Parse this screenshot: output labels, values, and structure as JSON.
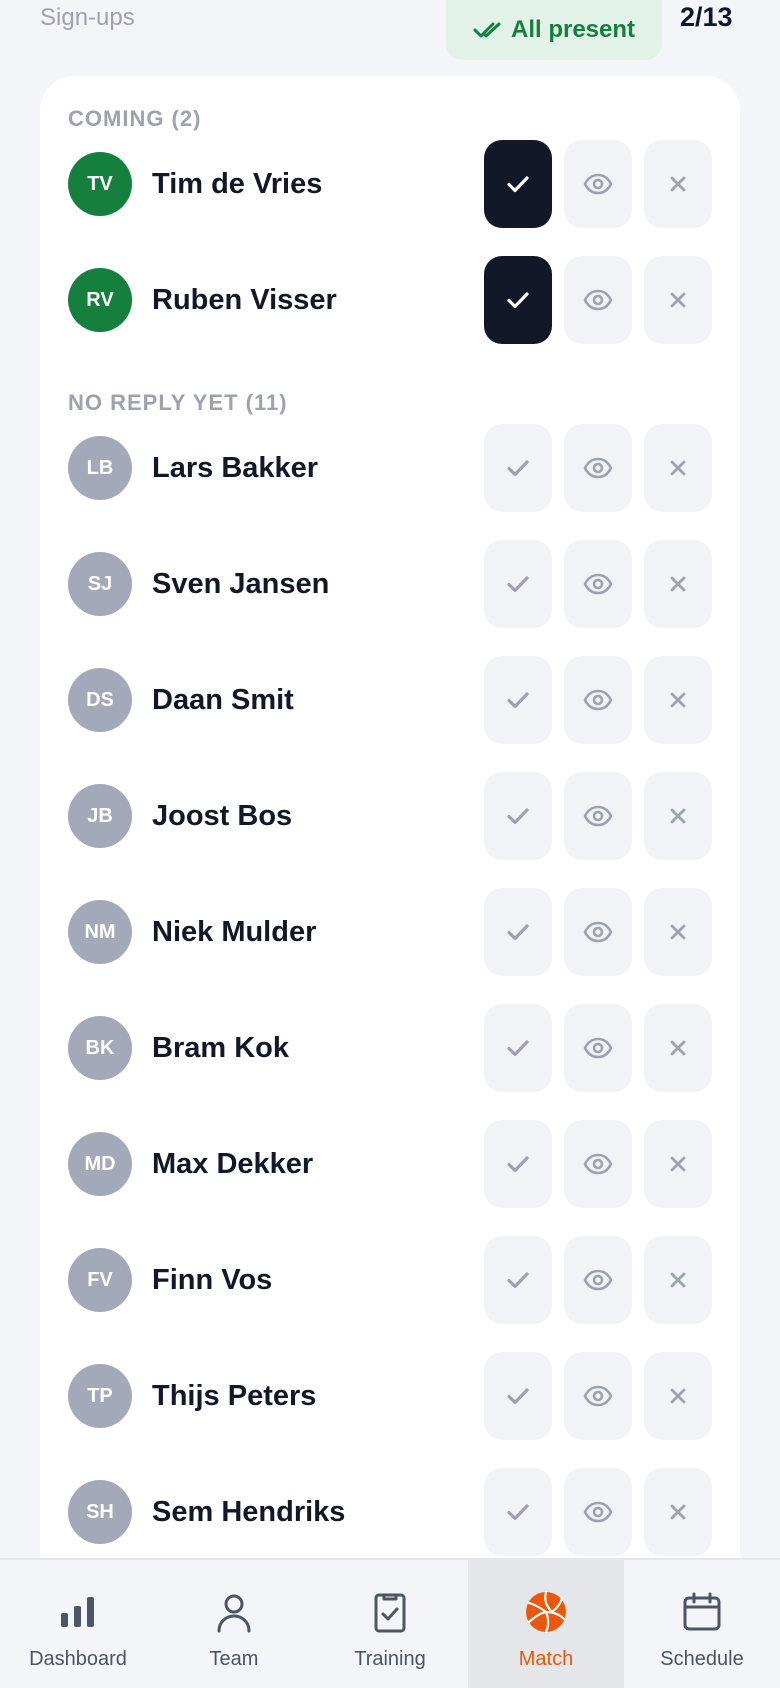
{
  "header": {
    "label": "Sign-ups",
    "badge": "All present",
    "count": "2/13"
  },
  "sections": {
    "coming": {
      "title": "COMING (2)",
      "players": [
        {
          "initials": "TV",
          "name": "Tim de Vries",
          "status": "yes"
        },
        {
          "initials": "RV",
          "name": "Ruben Visser",
          "status": "yes"
        }
      ]
    },
    "no_reply": {
      "title": "NO REPLY YET (11)",
      "players": [
        {
          "initials": "LB",
          "name": "Lars Bakker",
          "status": "none"
        },
        {
          "initials": "SJ",
          "name": "Sven Jansen",
          "status": "none"
        },
        {
          "initials": "DS",
          "name": "Daan Smit",
          "status": "none"
        },
        {
          "initials": "JB",
          "name": "Joost Bos",
          "status": "none"
        },
        {
          "initials": "NM",
          "name": "Niek Mulder",
          "status": "none"
        },
        {
          "initials": "BK",
          "name": "Bram Kok",
          "status": "none"
        },
        {
          "initials": "MD",
          "name": "Max Dekker",
          "status": "none"
        },
        {
          "initials": "FV",
          "name": "Finn Vos",
          "status": "none"
        },
        {
          "initials": "TP",
          "name": "Thijs Peters",
          "status": "none"
        },
        {
          "initials": "SH",
          "name": "Sem Hendriks",
          "status": "none"
        }
      ]
    }
  },
  "nav": {
    "items": [
      {
        "label": "Dashboard",
        "icon": "bar-chart-icon"
      },
      {
        "label": "Team",
        "icon": "user-icon"
      },
      {
        "label": "Training",
        "icon": "clipboard-check-icon"
      },
      {
        "label": "Match",
        "icon": "volleyball-icon",
        "active": true
      },
      {
        "label": "Schedule",
        "icon": "calendar-icon"
      }
    ]
  },
  "colors": {
    "accent": "#ea580c",
    "coming_avatar": "#15803d",
    "pending_avatar": "#a3a9b8",
    "active_button": "#111827",
    "badge_bg": "#e3f2e8",
    "badge_text": "#15803d"
  }
}
